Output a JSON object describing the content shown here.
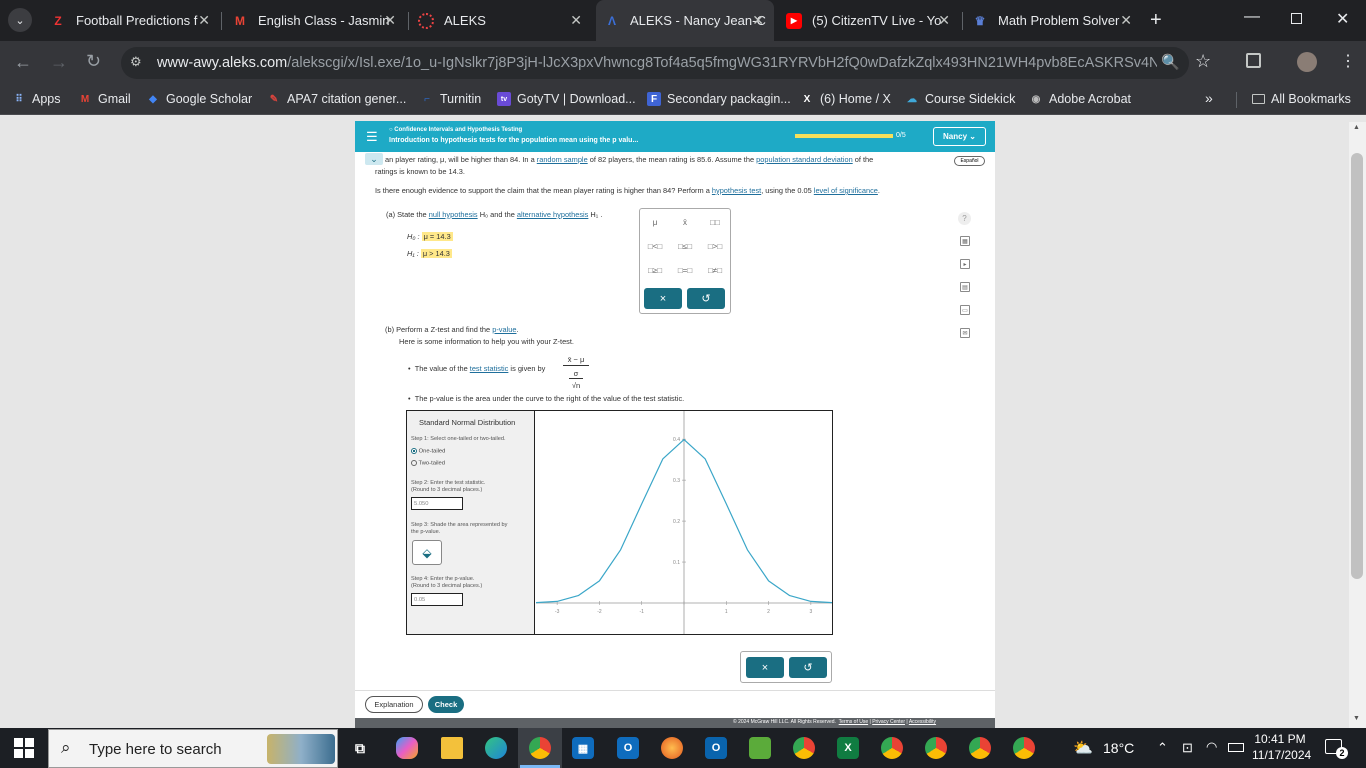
{
  "browser": {
    "tabs": [
      {
        "title": "Football Predictions f",
        "favicon": "zulubet-icon"
      },
      {
        "title": "English Class - Jasmin",
        "favicon": "gmail-icon"
      },
      {
        "title": "ALEKS",
        "favicon": "loading-icon"
      },
      {
        "title": "ALEKS - Nancy Jean-C",
        "favicon": "aleks-icon",
        "active": true
      },
      {
        "title": "(5) CitizenTV Live - Yo",
        "favicon": "youtube-icon"
      },
      {
        "title": "Math Problem Solver",
        "favicon": "mathway-icon"
      }
    ],
    "url_host": "www-awy.aleks.com",
    "url_path": "/alekscgi/x/Isl.exe/1o_u-IgNslkr7j8P3jH-lJcX3pxVhwncg8Tof4a5q5fmgWG31RYRVbH2fQ0wDafzkZqlx493HN21WH4pvb8EcASKRSv4N4D80m...",
    "bookmarks": [
      "Apps",
      "Gmail",
      "Google Scholar",
      "APA7 citation gener...",
      "Turnitin",
      "GotyTV | Download...",
      "Secondary packagin...",
      "(6) Home / X",
      "Course Sidekick",
      "Adobe Acrobat"
    ],
    "all_bookmarks": "All Bookmarks",
    "overflow": "»"
  },
  "aleks": {
    "topic": "Confidence Intervals and Hypothesis Testing",
    "title": "Introduction to hypothesis tests for the population mean using the p valu...",
    "progress": "0/5",
    "progress_fraction": 0,
    "user": "Nancy",
    "espanol": "Español",
    "problem_line1_a": "an player rating, μ, will be higher than 84. In a ",
    "random_sample": "random sample",
    "problem_line1_b": " of 82 players, the mean rating is 85.6. Assume the ",
    "pop_sd": "population standard deviation",
    "problem_line1_c": " of the",
    "problem_line2": "ratings is known to be 14.3.",
    "question_a": "Is there enough evidence to support the claim that the mean player rating is higher than 84? Perform a ",
    "hypothesis_test": "hypothesis test",
    "question_b": ", using the 0.05 ",
    "level_sig": "level of significance",
    "question_c": ".",
    "part_a_prefix": "(a) State the ",
    "null_hyp": "null hypothesis",
    "part_a_mid": " H₀ and the ",
    "alt_hyp": "alternative hypothesis",
    "part_a_suffix": " H₁ .",
    "h0_label": "H₀ :",
    "h0_value": "μ = 14.3",
    "h1_label": "H₁ :",
    "h1_value": "μ > 14.3",
    "palette": {
      "row1": [
        "μ",
        "x̄",
        "□□"
      ],
      "row2": [
        "□<□",
        "□≤□",
        "□>□"
      ],
      "row3": [
        "□≥□",
        "□=□",
        "□≠□"
      ],
      "clear": "×",
      "undo": "↺"
    },
    "part_b_prefix": "(b) Perform a Z-test and find the ",
    "p_value_link": "p-value",
    "part_b_suffix": ".",
    "info_line": "Here is some information to help you with your Z-test.",
    "bullet1_a": "The value of the ",
    "test_statistic": "test statistic",
    "bullet1_b": " is given by",
    "formula_num": "x̄ − μ",
    "formula_mid": "σ",
    "formula_den": "√n",
    "bullet2": "The p-value is the area under the curve to the right of the value of the test statistic.",
    "dist": {
      "title": "Standard Normal Distribution",
      "step1": "Step 1: Select one-tailed or two-tailed.",
      "opt1": "One-tailed",
      "opt2": "Two-tailed",
      "step2": "Step 2: Enter the test statistic.",
      "step2b": "(Round to 3 decimal places.)",
      "test_stat_value": "5.050",
      "step3": "Step 3: Shade the area represented by",
      "step3b": "the p-value.",
      "step4": "Step 4: Enter the p-value.",
      "step4b": "(Round to 3 decimal places.)",
      "p_value": "0.05"
    },
    "chart_data": {
      "type": "line",
      "x": [
        -3.5,
        -3,
        -2.5,
        -2,
        -1.5,
        -1,
        -0.5,
        0,
        0.5,
        1,
        1.5,
        2,
        2.5,
        3,
        3.5
      ],
      "y": [
        0.001,
        0.004,
        0.018,
        0.054,
        0.13,
        0.242,
        0.352,
        0.399,
        0.352,
        0.242,
        0.13,
        0.054,
        0.018,
        0.004,
        0.001
      ],
      "x_ticks": [
        "-3",
        "-2",
        "-1",
        "",
        "1",
        "2",
        "3"
      ],
      "y_ticks": [
        "0.1",
        "0.2",
        "0.3",
        "0.4"
      ],
      "xlim": [
        -3.5,
        3.5
      ],
      "ylim": [
        0,
        0.42
      ],
      "color": "#3aa6c8"
    },
    "bottom_clear": "×",
    "bottom_undo": "↺",
    "explanation": "Explanation",
    "check": "Check",
    "footer": "© 2024 McGraw Hill LLC. All Rights Reserved.",
    "terms": "Terms of Use",
    "privacy": "Privacy Center",
    "access": "Accessibility"
  },
  "taskbar": {
    "search": "Type here to search",
    "temp": "18°C",
    "time": "10:41 PM",
    "date": "11/17/2024",
    "notif": "2"
  }
}
